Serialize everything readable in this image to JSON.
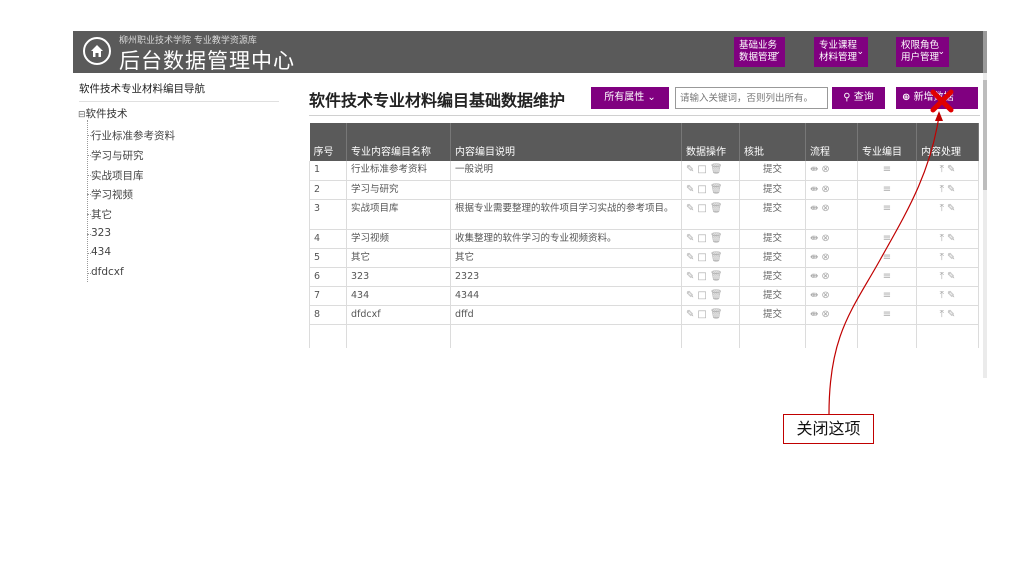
{
  "header": {
    "subtitle": "柳州职业技术学院 专业教学资源库",
    "title": "后台数据管理中心",
    "menus": [
      {
        "line1": "基础业务",
        "line2": "数据管理"
      },
      {
        "line1": "专业课程",
        "line2": "材料管理"
      },
      {
        "line1": "权限角色",
        "line2": "用户管理"
      }
    ]
  },
  "sidebar": {
    "title": "软件技术专业材料编目导航",
    "root": "软件技术",
    "items": [
      "行业标准参考资料",
      "学习与研究",
      "实战项目库",
      "学习视频",
      "其它",
      "323",
      "434",
      "dfdcxf"
    ]
  },
  "main": {
    "title": "软件技术专业材料编目基础数据维护",
    "attr_button": "所有属性",
    "search_placeholder": "请输入关键词，否则列出所有。",
    "query_button": "查询",
    "add_button": "新增数据"
  },
  "table": {
    "columns": [
      "序号",
      "专业内容编目名称",
      "内容编目说明",
      "数据操作",
      "核批",
      "流程",
      "专业编目",
      "内容处理"
    ],
    "rows": [
      {
        "no": "1",
        "name": "行业标准参考资料",
        "desc": "一般说明",
        "approve": "提交"
      },
      {
        "no": "2",
        "name": "学习与研究",
        "desc": "",
        "approve": "提交"
      },
      {
        "no": "3",
        "name": "实战项目库",
        "desc": "根据专业需要整理的软件项目学习实战的参考项目。",
        "approve": "提交"
      },
      {
        "no": "4",
        "name": "学习视频",
        "desc": "收集整理的软件学习的专业视频资料。",
        "approve": "提交"
      },
      {
        "no": "5",
        "name": "其它",
        "desc": "其它",
        "approve": "提交"
      },
      {
        "no": "6",
        "name": "323",
        "desc": "2323",
        "approve": "提交"
      },
      {
        "no": "7",
        "name": "434",
        "desc": "4344",
        "approve": "提交"
      },
      {
        "no": "8",
        "name": "dfdcxf",
        "desc": "dffd",
        "approve": "提交"
      }
    ]
  },
  "annotation": {
    "label": "关闭这项",
    "color": "#c00000"
  },
  "colors": {
    "header_bg": "#5a5a5a",
    "accent": "#800080"
  }
}
